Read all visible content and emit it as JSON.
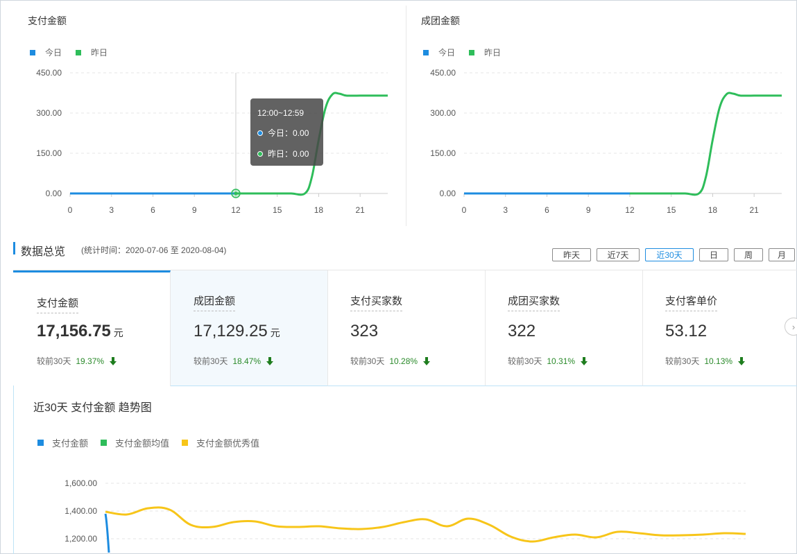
{
  "colors": {
    "today": "#1d8ce0",
    "yesterday": "#2ebd5a",
    "excellent": "#f7c519",
    "accent": "#1d8ce0"
  },
  "chart_data": [
    {
      "type": "line",
      "title": "支付金额",
      "legend": [
        "今日",
        "昨日"
      ],
      "xticks": [
        "0",
        "3",
        "6",
        "9",
        "12",
        "15",
        "18",
        "21"
      ],
      "yticks": [
        "0.00",
        "150.00",
        "300.00",
        "450.00"
      ],
      "ylim": [
        0,
        450
      ],
      "xlim": [
        0,
        23
      ],
      "series": [
        {
          "name": "今日",
          "x": [
            0,
            12
          ],
          "values": [
            0,
            0
          ]
        },
        {
          "name": "昨日",
          "x": [
            0,
            1,
            2,
            3,
            4,
            5,
            6,
            7,
            8,
            9,
            10,
            11,
            12,
            13,
            14,
            15,
            16,
            17,
            17.5,
            18,
            18.5,
            19,
            19.5,
            20,
            21,
            22,
            23
          ],
          "values": [
            0,
            0,
            0,
            0,
            0,
            0,
            0,
            0,
            0,
            0,
            0,
            0,
            0,
            0,
            0,
            0,
            0,
            0,
            60,
            200,
            320,
            370,
            372,
            365,
            365,
            365,
            365
          ]
        }
      ],
      "tooltip": {
        "title": "12:00~12:59",
        "rows": [
          {
            "label": "今日：",
            "value": "0.00"
          },
          {
            "label": "昨日：",
            "value": "0.00"
          }
        ]
      }
    },
    {
      "type": "line",
      "title": "成团金额",
      "legend": [
        "今日",
        "昨日"
      ],
      "xticks": [
        "0",
        "3",
        "6",
        "9",
        "12",
        "15",
        "18",
        "21"
      ],
      "yticks": [
        "0.00",
        "150.00",
        "300.00",
        "450.00"
      ],
      "ylim": [
        0,
        450
      ],
      "xlim": [
        0,
        23
      ],
      "series": [
        {
          "name": "今日",
          "x": [
            0,
            12
          ],
          "values": [
            0,
            0
          ]
        },
        {
          "name": "昨日",
          "x": [
            0,
            1,
            2,
            3,
            4,
            5,
            6,
            7,
            8,
            9,
            10,
            11,
            12,
            13,
            14,
            15,
            16,
            17,
            17.5,
            18,
            18.5,
            19,
            19.5,
            20,
            21,
            22,
            23
          ],
          "values": [
            0,
            0,
            0,
            0,
            0,
            0,
            0,
            0,
            0,
            0,
            0,
            0,
            0,
            0,
            0,
            0,
            0,
            0,
            60,
            200,
            320,
            370,
            372,
            365,
            365,
            365,
            365
          ]
        }
      ]
    },
    {
      "type": "line",
      "title": "近30天 支付金额 趋势图",
      "legend": [
        "支付金额",
        "支付金额均值",
        "支付金额优秀值"
      ],
      "yticks": [
        "1,200.00",
        "1,400.00",
        "1,600.00"
      ],
      "ylim": [
        1200,
        1600
      ],
      "series": [
        {
          "name": "支付金额",
          "values": [
            1380,
            1100
          ]
        },
        {
          "name": "支付金额优秀值",
          "values": [
            1395,
            1375,
            1420,
            1410,
            1300,
            1285,
            1320,
            1325,
            1290,
            1285,
            1290,
            1275,
            1270,
            1285,
            1320,
            1340,
            1290,
            1345,
            1300,
            1215,
            1180,
            1210,
            1230,
            1210,
            1250,
            1240,
            1225,
            1225,
            1230,
            1240,
            1235
          ]
        }
      ]
    }
  ],
  "overview": {
    "title": "数据总览",
    "subtitle": "(统计时间：2020-07-06 至 2020-08-04)",
    "ranges": [
      "昨天",
      "近7天",
      "近30天",
      "日",
      "周",
      "月"
    ],
    "active_range": 2
  },
  "cards": [
    {
      "label": "支付金额",
      "value": "17,156.75",
      "unit": "元",
      "compare": "较前30天",
      "pct": "19.37%"
    },
    {
      "label": "成团金额",
      "value": "17,129.25",
      "unit": "元",
      "compare": "较前30天",
      "pct": "18.47%"
    },
    {
      "label": "支付买家数",
      "value": "323",
      "unit": "",
      "compare": "较前30天",
      "pct": "10.28%"
    },
    {
      "label": "成团买家数",
      "value": "322",
      "unit": "",
      "compare": "较前30天",
      "pct": "10.31%"
    },
    {
      "label": "支付客单价",
      "value": "53.12",
      "unit": "",
      "compare": "较前30天",
      "pct": "10.13%"
    }
  ]
}
